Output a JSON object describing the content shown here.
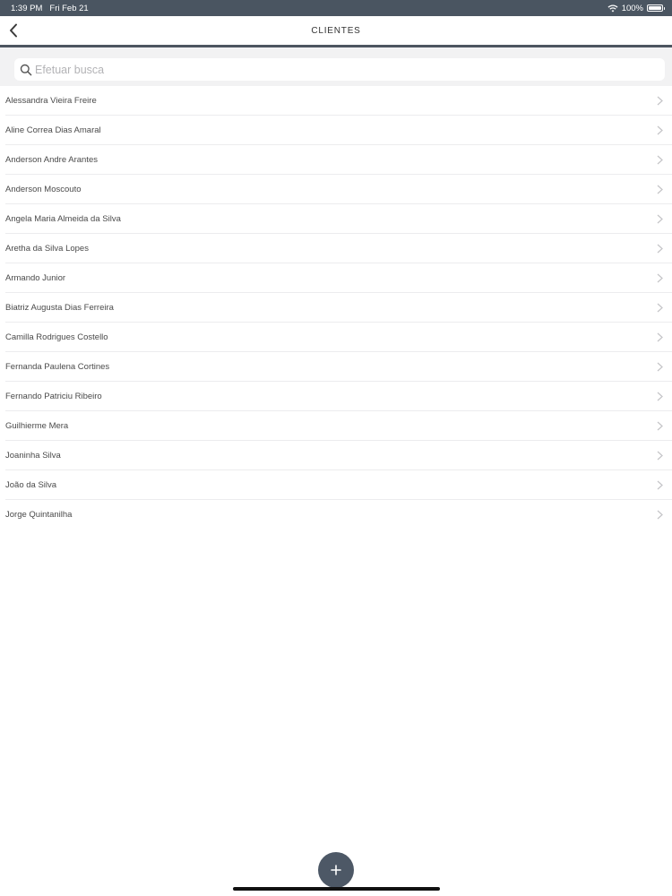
{
  "status_bar": {
    "time": "1:39 PM",
    "date": "Fri Feb 21",
    "battery": "100%",
    "battery_level": 1.0
  },
  "nav": {
    "title": "CLIENTES",
    "back_icon": "chevron-left-icon"
  },
  "search": {
    "value": "",
    "placeholder": "Efetuar busca"
  },
  "clients": [
    "Alessandra Vieira Freire",
    "Aline Correa Dias Amaral",
    "Anderson Andre Arantes",
    "Anderson Moscouto",
    "Angela Maria Almeida da Silva",
    "Aretha da Silva Lopes",
    "Armando Junior",
    "Biatriz Augusta Dias Ferreira",
    "Camilla Rodrigues Costello",
    "Fernanda Paulena Cortines",
    "Fernando Patriciu Ribeiro",
    "Guilhierme Mera",
    "Joaninha Silva",
    "João da Silva",
    "Jorge Quintanilha"
  ],
  "colors": {
    "accent": "#4d5866",
    "status_bar": "#4a5561",
    "search_background": "#f2f2f3"
  }
}
